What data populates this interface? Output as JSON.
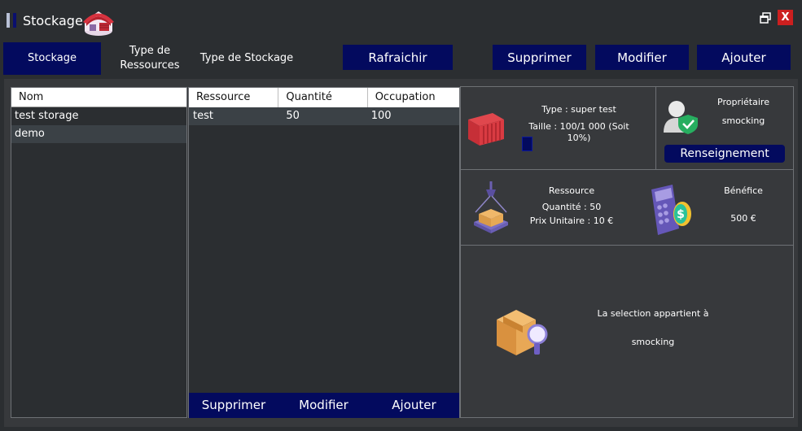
{
  "window": {
    "title": "Stockage",
    "close_label": "X"
  },
  "tabs": [
    {
      "label": "Stockage"
    },
    {
      "label": "Type de Ressources"
    },
    {
      "label": "Type de Stockage"
    }
  ],
  "toolbar": {
    "refresh_label": "Rafraichir",
    "delete_label": "Supprimer",
    "edit_label": "Modifier",
    "add_label": "Ajouter"
  },
  "storage_list": {
    "header": "Nom",
    "items": [
      {
        "name": "test storage"
      },
      {
        "name": "demo"
      }
    ]
  },
  "resources_table": {
    "columns": [
      "Ressource",
      "Quantité",
      "Occupation"
    ],
    "rows": [
      {
        "resource": "test",
        "quantity": "50",
        "occupation": "100"
      }
    ],
    "delete_label": "Supprimer",
    "edit_label": "Modifier",
    "add_label": "Ajouter"
  },
  "storage_info": {
    "type_text": "Type : super test",
    "size_text": "Taille : 100/1 000 (Soit 10%)",
    "fill_fraction": 0.1
  },
  "owner": {
    "label": "Propriétaire",
    "name": "smocking",
    "button_label": "Renseignement"
  },
  "resource_info": {
    "label": "Ressource",
    "quantity_text": "Quantité : 50",
    "unit_price_text": "Prix Unitaire : 10 €"
  },
  "profit": {
    "label": "Bénéfice",
    "value": "500 €"
  },
  "selection": {
    "message": "La selection appartient à",
    "owner": "smocking"
  },
  "colors": {
    "accent": "#030a5e",
    "background": "#2b2e31",
    "panel": "#37393c",
    "close": "#cc1f1f"
  },
  "icons": {
    "logo": "warehouse-icon",
    "container": "shipping-container-icon",
    "owner": "user-shield-icon",
    "resource": "crane-box-icon",
    "profit": "calculator-dollar-icon",
    "selection": "box-search-icon"
  }
}
